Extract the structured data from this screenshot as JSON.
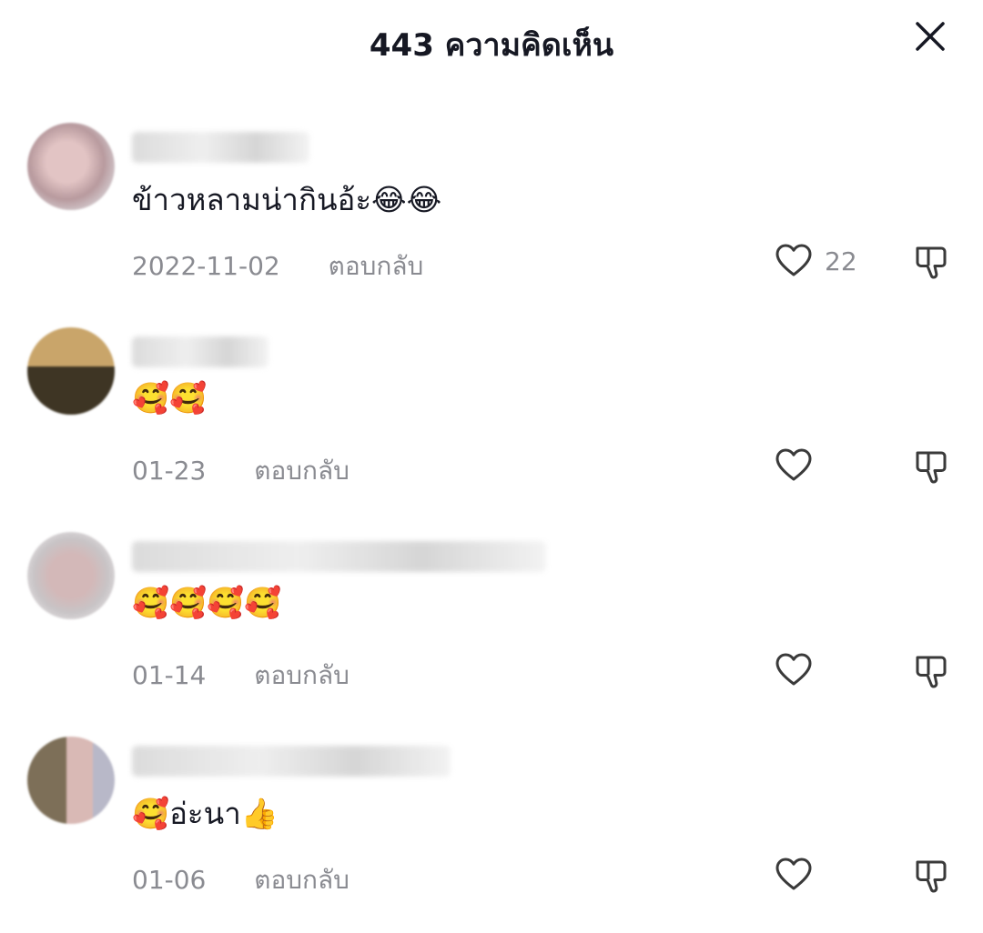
{
  "header": {
    "title": "443 ความคิดเห็น"
  },
  "icons": {
    "close": "close-icon",
    "like": "heart-outline-icon",
    "dislike": "thumbs-down-outline-icon"
  },
  "colors": {
    "text_primary": "#161823",
    "text_secondary": "#8a8b91",
    "icon": "#3a3a3a",
    "background": "#ffffff"
  },
  "comments": [
    {
      "text": "ข้าวหลามน่ากินอ้ะ😂😂",
      "date": "2022-11-02",
      "reply_label": "ตอบกลับ",
      "like_count": "22"
    },
    {
      "text": "🥰🥰",
      "date": "01-23",
      "reply_label": "ตอบกลับ",
      "like_count": ""
    },
    {
      "text": "🥰🥰🥰🥰",
      "date": "01-14",
      "reply_label": "ตอบกลับ",
      "like_count": ""
    },
    {
      "text": "🥰อ่ะนา👍",
      "date": "01-06",
      "reply_label": "ตอบกลับ",
      "like_count": ""
    }
  ]
}
